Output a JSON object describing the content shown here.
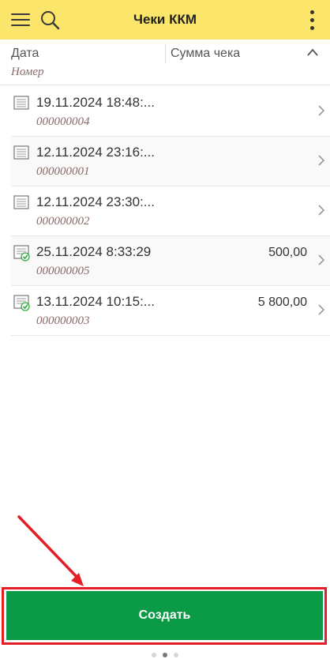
{
  "app": {
    "title": "Чеки ККМ",
    "accent_color": "#fbe66b",
    "icons": [
      "menu-icon",
      "search-icon",
      "kebab-menu-icon"
    ]
  },
  "columns": {
    "date": "Дата",
    "sum": "Сумма чека",
    "number": "Номер",
    "sort_icon": "chevron-up-icon"
  },
  "rows": [
    {
      "date": "19.11.2024 18:48:...",
      "number": "000000004",
      "sum": "",
      "status": "document"
    },
    {
      "date": "12.11.2024 23:16:...",
      "number": "000000001",
      "sum": "",
      "status": "document"
    },
    {
      "date": "12.11.2024 23:30:...",
      "number": "000000002",
      "sum": "",
      "status": "document"
    },
    {
      "date": "25.11.2024 8:33:29",
      "number": "000000005",
      "sum": "500,00",
      "status": "posted-document"
    },
    {
      "date": "13.11.2024 10:15:...",
      "number": "000000003",
      "sum": "5 800,00",
      "status": "posted-document"
    }
  ],
  "footer": {
    "create_label": "Создать",
    "button_color": "#0b9a45",
    "highlight_color": "#e41e26",
    "page_count": 3,
    "active_page": 2
  }
}
